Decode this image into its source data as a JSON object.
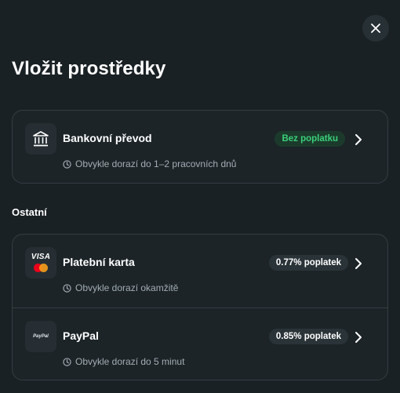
{
  "dialog": {
    "close_label": "×",
    "title": "Vložit prostředky"
  },
  "bank": {
    "name": "Bankovní převod",
    "badge": "Bez poplatku",
    "eta": "Obvykle dorazí do 1–2 pracovních dnů",
    "icon": "bank-icon"
  },
  "other": {
    "label": "Ostatní",
    "methods": [
      {
        "name": "Platební karta",
        "badge": "0.77% poplatek",
        "eta": "Obvykle dorazí okamžitě",
        "logo_text": "VISA",
        "icon": "card-logos-icon"
      },
      {
        "name": "PayPal",
        "badge": "0.85% poplatek",
        "eta": "Obvykle dorazí do 5 minut",
        "logo_text": "PayPal",
        "icon": "paypal-icon"
      }
    ]
  },
  "colors": {
    "background": "#1a2125",
    "card_border": "#343d43",
    "free_badge_text": "#3ad07a",
    "free_badge_bg": "#1c3a2c",
    "fee_badge_bg": "#2a3338",
    "muted_text": "#a3adb3"
  }
}
